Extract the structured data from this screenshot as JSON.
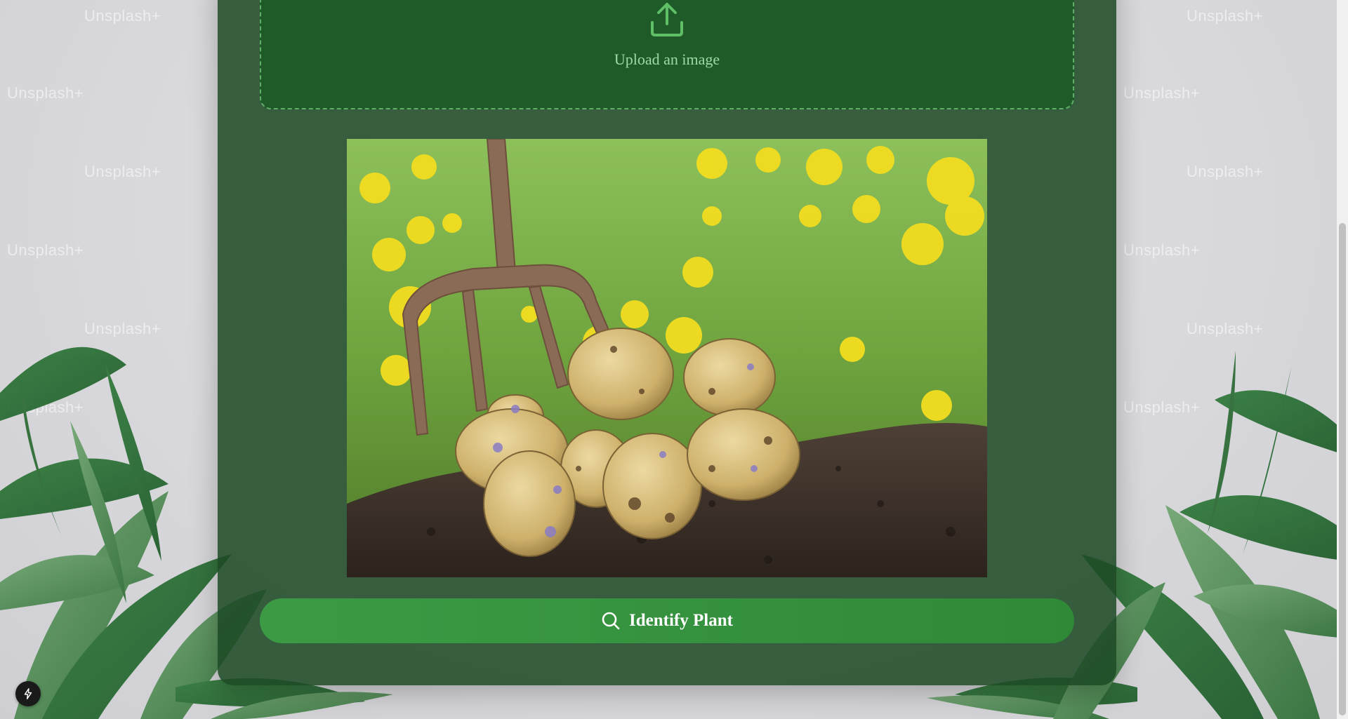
{
  "upload": {
    "label": "Upload an image",
    "icon": "upload-icon"
  },
  "preview": {
    "icon": "potato-photo"
  },
  "identify_button": {
    "label": "Identify Plant",
    "icon": "search-icon"
  },
  "background": {
    "watermark_text": "Unsplash+"
  },
  "dev_badge": {
    "icon": "lightning-icon"
  },
  "colors": {
    "card": "#1c4824",
    "upload_zone": "#1f5a29",
    "accent": "#3c9a44",
    "upload_text": "#9fd9a3"
  }
}
